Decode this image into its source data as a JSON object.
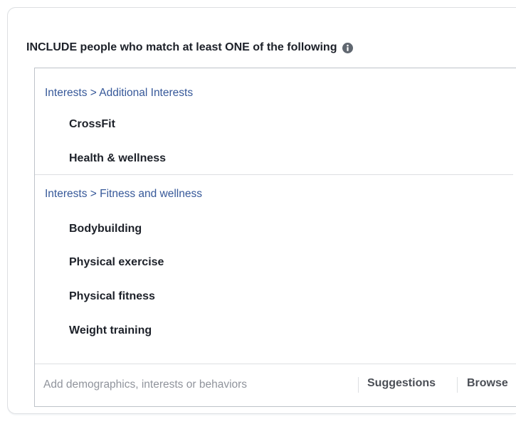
{
  "heading": {
    "text": "INCLUDE people who match at least ONE of the following",
    "icon": "info-icon"
  },
  "groups": [
    {
      "category": "Interests > Additional Interests",
      "items": [
        "CrossFit",
        "Health & wellness"
      ]
    },
    {
      "category": "Interests > Fitness and wellness",
      "items": [
        "Bodybuilding",
        "Physical exercise",
        "Physical fitness",
        "Weight training"
      ]
    }
  ],
  "search": {
    "placeholder": "Add demographics, interests or behaviors",
    "value": ""
  },
  "actions": {
    "suggestions_label": "Suggestions",
    "browse_label": "Browse"
  },
  "colors": {
    "category_link": "#365899",
    "text": "#1d2129",
    "border": "#bec3c9",
    "panel_bg": "#f6f7f9"
  }
}
